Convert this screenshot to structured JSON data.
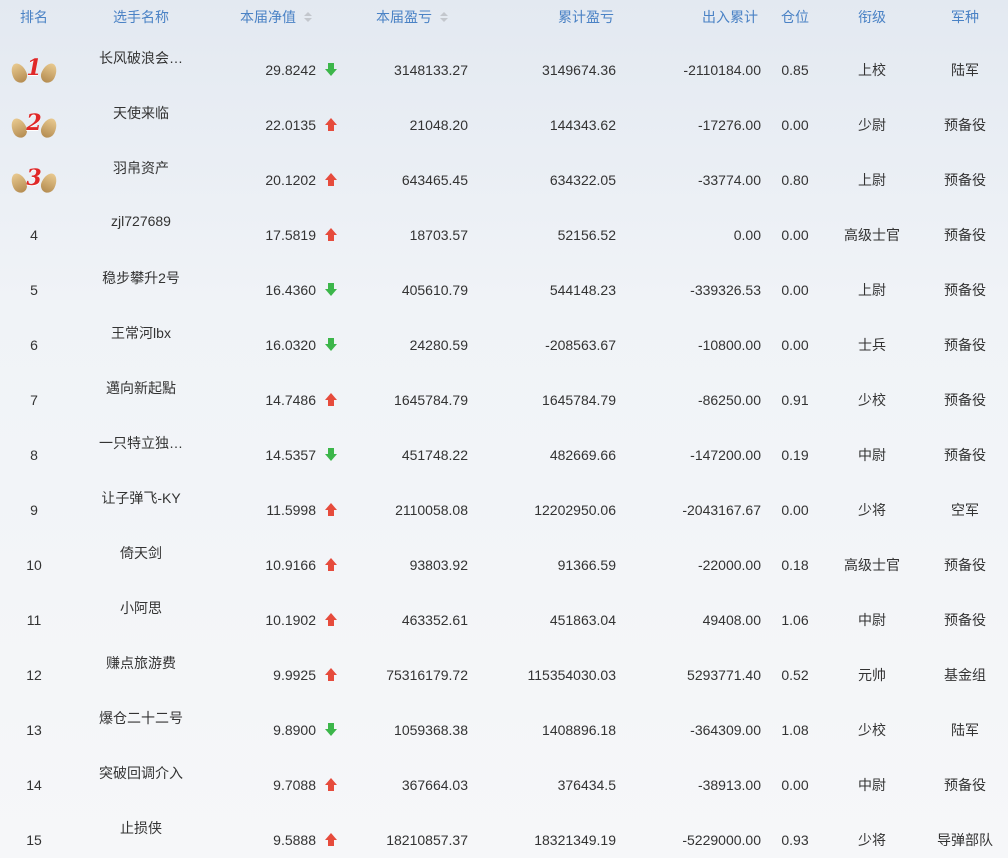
{
  "headers": {
    "rank": "排名",
    "name": "选手名称",
    "nav": "本届净值",
    "pnl": "本届盈亏",
    "cum_pnl": "累计盈亏",
    "flow": "出入累计",
    "position": "仓位",
    "grade": "衔级",
    "branch": "军种"
  },
  "colors": {
    "header_text": "#4a82c5",
    "up": "#e64b3c",
    "down": "#3cb64a",
    "medal_number": "#e02828"
  },
  "rows": [
    {
      "rank": "1",
      "name": "长风破浪会…",
      "nav": "29.8242",
      "trend": "down",
      "pnl": "3148133.27",
      "cum": "3149674.36",
      "flow": "-2110184.00",
      "pos": "0.85",
      "grade": "上校",
      "branch": "陆军"
    },
    {
      "rank": "2",
      "name": "天使来临",
      "nav": "22.0135",
      "trend": "up",
      "pnl": "21048.20",
      "cum": "144343.62",
      "flow": "-17276.00",
      "pos": "0.00",
      "grade": "少尉",
      "branch": "预备役"
    },
    {
      "rank": "3",
      "name": "羽帛资产",
      "nav": "20.1202",
      "trend": "up",
      "pnl": "643465.45",
      "cum": "634322.05",
      "flow": "-33774.00",
      "pos": "0.80",
      "grade": "上尉",
      "branch": "预备役"
    },
    {
      "rank": "4",
      "name": "zjl727689",
      "nav": "17.5819",
      "trend": "up",
      "pnl": "18703.57",
      "cum": "52156.52",
      "flow": "0.00",
      "pos": "0.00",
      "grade": "高级士官",
      "branch": "预备役"
    },
    {
      "rank": "5",
      "name": "稳步攀升2号",
      "nav": "16.4360",
      "trend": "down",
      "pnl": "405610.79",
      "cum": "544148.23",
      "flow": "-339326.53",
      "pos": "0.00",
      "grade": "上尉",
      "branch": "预备役"
    },
    {
      "rank": "6",
      "name": "王常河lbx",
      "nav": "16.0320",
      "trend": "down",
      "pnl": "24280.59",
      "cum": "-208563.67",
      "flow": "-10800.00",
      "pos": "0.00",
      "grade": "士兵",
      "branch": "预备役"
    },
    {
      "rank": "7",
      "name": "邁向新起點",
      "nav": "14.7486",
      "trend": "up",
      "pnl": "1645784.79",
      "cum": "1645784.79",
      "flow": "-86250.00",
      "pos": "0.91",
      "grade": "少校",
      "branch": "预备役"
    },
    {
      "rank": "8",
      "name": "一只特立独…",
      "nav": "14.5357",
      "trend": "down",
      "pnl": "451748.22",
      "cum": "482669.66",
      "flow": "-147200.00",
      "pos": "0.19",
      "grade": "中尉",
      "branch": "预备役"
    },
    {
      "rank": "9",
      "name": "让子弹飞-KY",
      "nav": "11.5998",
      "trend": "up",
      "pnl": "2110058.08",
      "cum": "12202950.06",
      "flow": "-2043167.67",
      "pos": "0.00",
      "grade": "少将",
      "branch": "空军"
    },
    {
      "rank": "10",
      "name": "倚天剑",
      "nav": "10.9166",
      "trend": "up",
      "pnl": "93803.92",
      "cum": "91366.59",
      "flow": "-22000.00",
      "pos": "0.18",
      "grade": "高级士官",
      "branch": "预备役"
    },
    {
      "rank": "11",
      "name": "小阿思",
      "nav": "10.1902",
      "trend": "up",
      "pnl": "463352.61",
      "cum": "451863.04",
      "flow": "49408.00",
      "pos": "1.06",
      "grade": "中尉",
      "branch": "预备役"
    },
    {
      "rank": "12",
      "name": "赚点旅游费",
      "nav": "9.9925",
      "trend": "up",
      "pnl": "75316179.72",
      "cum": "115354030.03",
      "flow": "5293771.40",
      "pos": "0.52",
      "grade": "元帅",
      "branch": "基金组"
    },
    {
      "rank": "13",
      "name": "爆仓二十二号",
      "nav": "9.8900",
      "trend": "down",
      "pnl": "1059368.38",
      "cum": "1408896.18",
      "flow": "-364309.00",
      "pos": "1.08",
      "grade": "少校",
      "branch": "陆军"
    },
    {
      "rank": "14",
      "name": "突破回调介入",
      "nav": "9.7088",
      "trend": "up",
      "pnl": "367664.03",
      "cum": "376434.5",
      "flow": "-38913.00",
      "pos": "0.00",
      "grade": "中尉",
      "branch": "预备役"
    },
    {
      "rank": "15",
      "name": "止损侠",
      "nav": "9.5888",
      "trend": "up",
      "pnl": "18210857.37",
      "cum": "18321349.19",
      "flow": "-5229000.00",
      "pos": "0.93",
      "grade": "少将",
      "branch": "导弹部队"
    }
  ]
}
